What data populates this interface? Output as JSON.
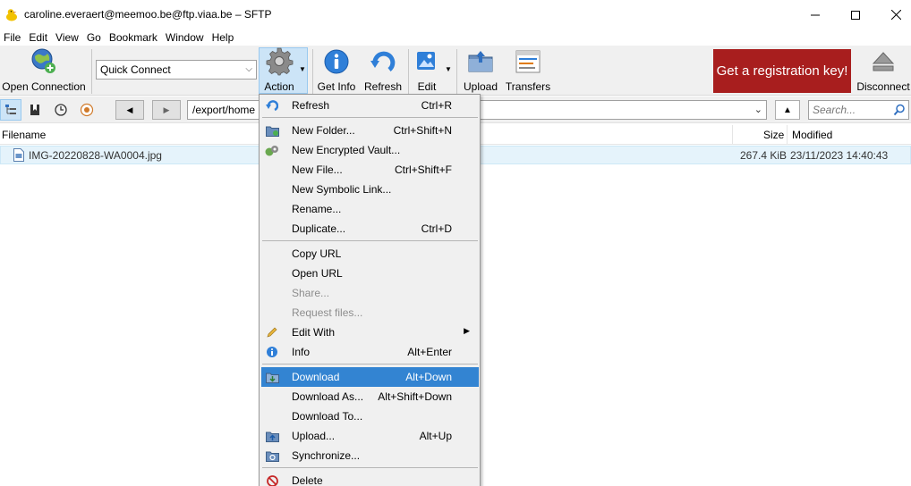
{
  "window": {
    "title": "caroline.everaert@meemoo.be@ftp.viaa.be – SFTP"
  },
  "menubar": [
    "File",
    "Edit",
    "View",
    "Go",
    "Bookmark",
    "Window",
    "Help"
  ],
  "toolbar": {
    "open_connection": "Open Connection",
    "quick_connect": "Quick Connect",
    "action": "Action",
    "get_info": "Get Info",
    "refresh": "Refresh",
    "edit": "Edit",
    "upload": "Upload",
    "transfers": "Transfers",
    "registration": "Get a registration key!",
    "disconnect": "Disconnect"
  },
  "navbar": {
    "path": "/export/home",
    "search_placeholder": "Search..."
  },
  "file_list": {
    "columns": {
      "filename": "Filename",
      "size": "Size",
      "modified": "Modified"
    },
    "rows": [
      {
        "name": "IMG-20220828-WA0004.jpg",
        "size": "267.4 KiB",
        "modified": "23/11/2023 14:40:43"
      }
    ]
  },
  "action_menu": {
    "items": [
      {
        "label": "Refresh",
        "shortcut": "Ctrl+R",
        "icon": "refresh-icon"
      },
      {
        "label": "New Folder...",
        "shortcut": "Ctrl+Shift+N",
        "icon": "folder-icon"
      },
      {
        "label": "New Encrypted Vault...",
        "shortcut": "",
        "icon": "vault-icon"
      },
      {
        "label": "New File...",
        "shortcut": "Ctrl+Shift+F",
        "icon": ""
      },
      {
        "label": "New Symbolic Link...",
        "shortcut": "",
        "icon": ""
      },
      {
        "label": "Rename...",
        "shortcut": "",
        "icon": ""
      },
      {
        "label": "Duplicate...",
        "shortcut": "Ctrl+D",
        "icon": ""
      },
      {
        "label": "Copy URL",
        "shortcut": "",
        "icon": ""
      },
      {
        "label": "Open URL",
        "shortcut": "",
        "icon": ""
      },
      {
        "label": "Share...",
        "shortcut": "",
        "icon": "",
        "disabled": true
      },
      {
        "label": "Request files...",
        "shortcut": "",
        "icon": "",
        "disabled": true
      },
      {
        "label": "Edit With",
        "shortcut": "",
        "icon": "pencil-icon",
        "submenu": true
      },
      {
        "label": "Info",
        "shortcut": "Alt+Enter",
        "icon": "info-icon"
      },
      {
        "label": "Download",
        "shortcut": "Alt+Down",
        "icon": "download-icon",
        "highlighted": true
      },
      {
        "label": "Download As...",
        "shortcut": "Alt+Shift+Down",
        "icon": ""
      },
      {
        "label": "Download To...",
        "shortcut": "",
        "icon": ""
      },
      {
        "label": "Upload...",
        "shortcut": "Alt+Up",
        "icon": "upload-icon"
      },
      {
        "label": "Synchronize...",
        "shortcut": "",
        "icon": "sync-icon"
      },
      {
        "label": "Delete",
        "shortcut": "",
        "icon": "delete-icon"
      }
    ]
  },
  "colors": {
    "highlight": "#3384d2",
    "registration_bg": "#a81e1e",
    "selected_row": "#e5f3fb"
  }
}
